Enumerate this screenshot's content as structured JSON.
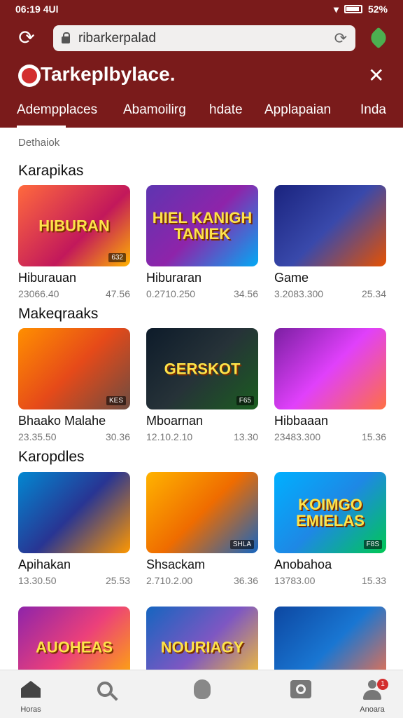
{
  "status_bar": {
    "time": "06:19 4Ul",
    "battery": "52%"
  },
  "browser": {
    "url": "ribarkerpalad"
  },
  "app": {
    "brand": "Tarkeplbylace."
  },
  "tabs": [
    {
      "label": "Adempplaces"
    },
    {
      "label": "Abamoilirg"
    },
    {
      "label": "hdate"
    },
    {
      "label": "Applapaian"
    },
    {
      "label": "Inda"
    }
  ],
  "breadcrumb": "Dethaiok",
  "sections": [
    {
      "title": "Karapikas",
      "items": [
        {
          "title": "Hiburauan",
          "id": "23066.40",
          "price": "47.56",
          "art_text": "HIBURAN",
          "badge": "632",
          "bg": "linear-gradient(135deg,#ff6a3d,#c2185b 60%,#ffb300)"
        },
        {
          "title": "Hiburaran",
          "id": "0.2710.250",
          "price": "34.56",
          "art_text": "HIEL KANIGH TANIEK",
          "badge": "",
          "bg": "linear-gradient(135deg,#5e35b1,#8e24aa 50%,#03a9f4)"
        },
        {
          "title": "Game",
          "id": "3.2083.300",
          "price": "25.34",
          "art_text": "",
          "badge": "",
          "bg": "linear-gradient(135deg,#1a237e,#3949ab 50%,#e65100)"
        }
      ]
    },
    {
      "title": "Makeqraaks",
      "items": [
        {
          "title": "Bhaako Malahe",
          "id": "23.35.50",
          "price": "30.36",
          "art_text": "",
          "badge": "KES",
          "bg": "linear-gradient(135deg,#ff8f00,#e64a19 50%,#6d4c41)"
        },
        {
          "title": "Mboarnan",
          "id": "12.10.2.10",
          "price": "13.30",
          "art_text": "GERSKOT",
          "badge": "F65",
          "bg": "linear-gradient(135deg,#0d1b2a,#263238 50%,#1b5e20)"
        },
        {
          "title": "Hibbaaan",
          "id": "23483.300",
          "price": "15.36",
          "art_text": "",
          "badge": "",
          "bg": "linear-gradient(135deg,#7b1fa2,#e040fb 50%,#ff7043)"
        }
      ]
    },
    {
      "title": "Karopdles",
      "items": [
        {
          "title": "Apihakan",
          "id": "13.30.50",
          "price": "25.53",
          "art_text": "",
          "badge": "",
          "bg": "linear-gradient(135deg,#0288d1,#283593 50%,#ff9800)"
        },
        {
          "title": "Shsackam",
          "id": "2.710.2.00",
          "price": "36.36",
          "art_text": "",
          "badge": "SHLA",
          "bg": "linear-gradient(135deg,#ffb300,#ef6c00 50%,#1565c0)"
        },
        {
          "title": "Anobahoa",
          "id": "13783.00",
          "price": "15.33",
          "art_text": "KOIMGO EMIELAS",
          "badge": "F8S",
          "bg": "linear-gradient(135deg,#00b0ff,#1e88e5 50%,#00c853)"
        }
      ]
    },
    {
      "title": "",
      "items": [
        {
          "title": "",
          "id": "",
          "price": "",
          "art_text": "AUOHEAS",
          "badge": "",
          "bg": "linear-gradient(135deg,#8e24aa,#ec407a 50%,#ffb300)"
        },
        {
          "title": "",
          "id": "",
          "price": "",
          "art_text": "NOURIAGY",
          "badge": "",
          "bg": "linear-gradient(135deg,#1565c0,#7e57c2 50%,#ffca28)"
        },
        {
          "title": "",
          "id": "",
          "price": "",
          "art_text": "",
          "badge": "",
          "bg": "linear-gradient(135deg,#0d47a1,#1976d2 50%,#ff7043)"
        }
      ]
    }
  ],
  "bottom_nav": [
    {
      "label": "Horas",
      "icon": "home-icon"
    },
    {
      "label": "",
      "icon": "search-icon"
    },
    {
      "label": "",
      "icon": "shield-icon"
    },
    {
      "label": "",
      "icon": "camera-icon"
    },
    {
      "label": "Anoara",
      "icon": "user-icon",
      "badge": "1"
    }
  ]
}
